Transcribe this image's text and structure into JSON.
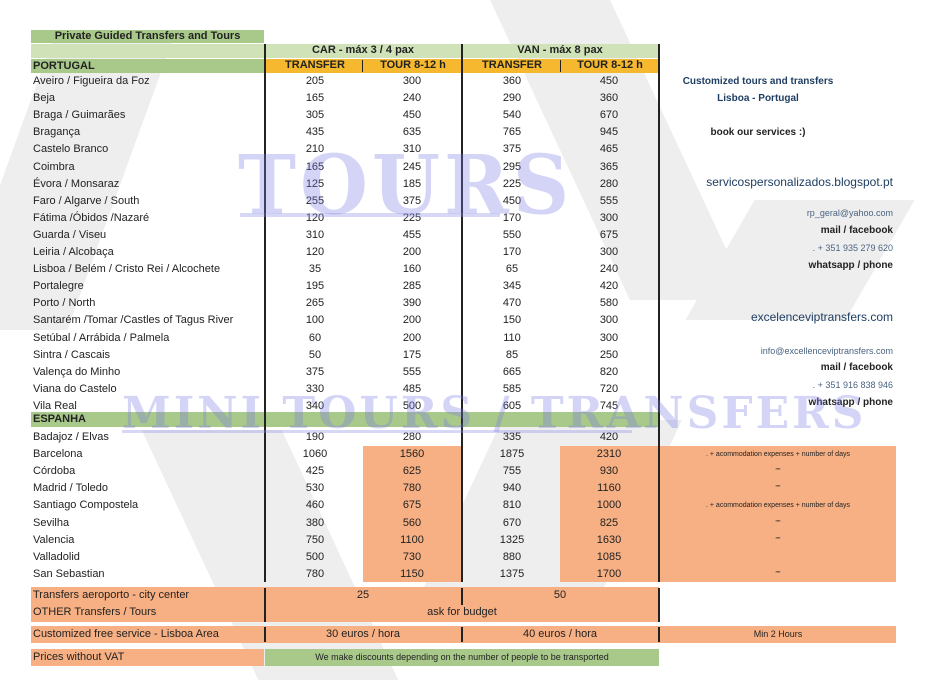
{
  "title": "Private Guided Transfers and Tours",
  "watermarks": {
    "big": "TOURS",
    "banner": "MINI TOURS / TRANSFERS"
  },
  "groups": {
    "car": "CAR - máx 3 / 4 pax",
    "van": "VAN - máx 8 pax"
  },
  "columns": {
    "transfer": "TRANSFER",
    "tour": "TOUR 8-12 h"
  },
  "portugal": {
    "label": "PORTUGAL",
    "rows": [
      {
        "name": "Aveiro / Figueira da Foz",
        "car_t": "205",
        "car_tour": "300",
        "van_t": "360",
        "van_tour": "450"
      },
      {
        "name": "Beja",
        "car_t": "165",
        "car_tour": "240",
        "van_t": "290",
        "van_tour": "360"
      },
      {
        "name": "Braga / Guimarães",
        "car_t": "305",
        "car_tour": "450",
        "van_t": "540",
        "van_tour": "670"
      },
      {
        "name": "Bragança",
        "car_t": "435",
        "car_tour": "635",
        "van_t": "765",
        "van_tour": "945"
      },
      {
        "name": "Castelo Branco",
        "car_t": "210",
        "car_tour": "310",
        "van_t": "375",
        "van_tour": "465"
      },
      {
        "name": "Coimbra",
        "car_t": "165",
        "car_tour": "245",
        "van_t": "295",
        "van_tour": "365"
      },
      {
        "name": "Évora / Monsaraz",
        "car_t": "125",
        "car_tour": "185",
        "van_t": "225",
        "van_tour": "280"
      },
      {
        "name": "Faro / Algarve / South",
        "car_t": "255",
        "car_tour": "375",
        "van_t": "450",
        "van_tour": "555"
      },
      {
        "name": "Fátima /Óbidos /Nazaré",
        "car_t": "120",
        "car_tour": "225",
        "van_t": "170",
        "van_tour": "300"
      },
      {
        "name": "Guarda / Viseu",
        "car_t": "310",
        "car_tour": "455",
        "van_t": "550",
        "van_tour": "675"
      },
      {
        "name": "Leiria / Alcobaça",
        "car_t": "120",
        "car_tour": "200",
        "van_t": "170",
        "van_tour": "300"
      },
      {
        "name": "Lisboa / Belém / Cristo Rei / Alcochete",
        "car_t": "35",
        "car_tour": "160",
        "van_t": "65",
        "van_tour": "240"
      },
      {
        "name": "Portalegre",
        "car_t": "195",
        "car_tour": "285",
        "van_t": "345",
        "van_tour": "420"
      },
      {
        "name": "Porto / North",
        "car_t": "265",
        "car_tour": "390",
        "van_t": "470",
        "van_tour": "580"
      },
      {
        "name": "Santarém /Tomar /Castles of Tagus River",
        "car_t": "100",
        "car_tour": "200",
        "van_t": "150",
        "van_tour": "300"
      },
      {
        "name": "Setúbal / Arrábida / Palmela",
        "car_t": "60",
        "car_tour": "200",
        "van_t": "110",
        "van_tour": "300"
      },
      {
        "name": "Sintra / Cascais",
        "car_t": "50",
        "car_tour": "175",
        "van_t": "85",
        "van_tour": "250"
      },
      {
        "name": "Valença do Minho",
        "car_t": "375",
        "car_tour": "555",
        "van_t": "665",
        "van_tour": "820"
      },
      {
        "name": "Viana do Castelo",
        "car_t": "330",
        "car_tour": "485",
        "van_t": "585",
        "van_tour": "720"
      },
      {
        "name": "Vila Real",
        "car_t": "340",
        "car_tour": "500",
        "van_t": "605",
        "van_tour": "745"
      }
    ]
  },
  "espanha": {
    "label": "ESPANHA",
    "rows": [
      {
        "name": "Badajoz / Elvas",
        "car_t": "190",
        "car_tour": "280",
        "van_t": "335",
        "van_tour": "420",
        "note": ""
      },
      {
        "name": "Barcelona",
        "car_t": "1060",
        "car_tour": "1560",
        "van_t": "1875",
        "van_tour": "2310",
        "note": ". + acommodation expenses + number of days"
      },
      {
        "name": "Córdoba",
        "car_t": "425",
        "car_tour": "625",
        "van_t": "755",
        "van_tour": "930",
        "note": "\"\""
      },
      {
        "name": "Madrid / Toledo",
        "car_t": "530",
        "car_tour": "780",
        "van_t": "940",
        "van_tour": "1160",
        "note": "\"\""
      },
      {
        "name": "Santiago Compostela",
        "car_t": "460",
        "car_tour": "675",
        "van_t": "810",
        "van_tour": "1000",
        "note": ". + acommodation expenses + number of days"
      },
      {
        "name": "Sevilha",
        "car_t": "380",
        "car_tour": "560",
        "van_t": "670",
        "van_tour": "825",
        "note": "\"\""
      },
      {
        "name": "Valencia",
        "car_t": "750",
        "car_tour": "1100",
        "van_t": "1325",
        "van_tour": "1630",
        "note": "\"\""
      },
      {
        "name": "Valladolid",
        "car_t": "500",
        "car_tour": "730",
        "van_t": "880",
        "van_tour": "1085",
        "note": ""
      },
      {
        "name": "San Sebastian",
        "car_t": "780",
        "car_tour": "1150",
        "van_t": "1375",
        "van_tour": "1700",
        "note": "\"\""
      }
    ]
  },
  "extras": {
    "airport": {
      "label": "Transfers aeroporto - city center",
      "car": "25",
      "van": "50"
    },
    "other": {
      "label": "OTHER Transfers / Tours",
      "value": "ask for budget"
    },
    "custom": {
      "label": "Customized free service - Lisboa Area",
      "car": "30 euros / hora",
      "van": "40 euros / hora",
      "note": "Min 2 Hours"
    },
    "vat": {
      "label": "Prices without VAT",
      "note": "We make discounts depending on the number of people to be transported"
    }
  },
  "contact": {
    "tagline1": "Customized tours and transfers",
    "tagline2": "Lisboa - Portugal",
    "book": "book our services :)",
    "site1": "servicospersonalizados.blogspot.pt",
    "email1": "rp_geral@yahoo.com",
    "mailfb1": "mail / facebook",
    "phone1": ". + 351 935 279 620",
    "wa1": "whatsapp / phone",
    "site2": "excelenceviptransfers.com",
    "email2": "info@excellenceviptransfers.com",
    "mailfb2": "mail / facebook",
    "phone2": ". + 351 916 838 946",
    "wa2": "whatsapp / phone"
  }
}
